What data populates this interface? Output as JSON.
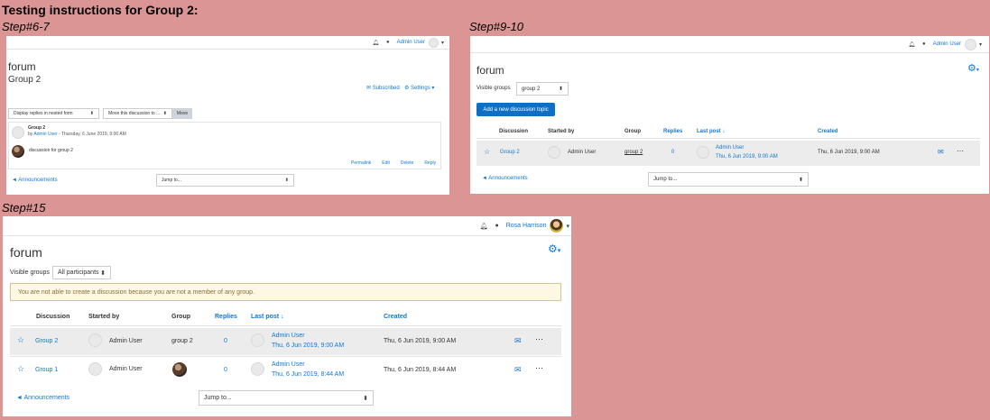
{
  "heading": "Testing instructions for Group 2:",
  "steps": {
    "s1": "Step#6-7",
    "s2": "Step#9-10",
    "s3": "Step#15"
  },
  "p1": {
    "user": "Admin User",
    "title": "forum",
    "subtitle": "Group 2",
    "subscribed": "Subscribed",
    "settings": "Settings",
    "display_select": "Display replies in nested form",
    "move_select": "Move this discussion to ...",
    "move_button": "Move",
    "post_title": "Group 2",
    "post_by": "by",
    "post_author": "Admin User",
    "post_date": " - Thursday, 6 June 2019, 9:00 AM",
    "post_body": "discussion for group 2",
    "actions": [
      "Permalink",
      "Edit",
      "Delete",
      "Reply"
    ],
    "announcements": "◄ Announcements",
    "jump": "Jump to..."
  },
  "p2": {
    "user": "Admin User",
    "title": "forum",
    "visible_groups_label": "Visible groups",
    "visible_groups_value": "group 2",
    "add_button": "Add a new discussion topic",
    "headers": {
      "discussion": "Discussion",
      "started_by": "Started by",
      "group": "Group",
      "replies": "Replies",
      "last_post": "Last post",
      "created": "Created"
    },
    "row": {
      "discussion": "Group 2",
      "started_by": "Admin User",
      "group": "group 2",
      "replies": "0",
      "last_user": "Admin User",
      "last_date": "Thu, 6 Jun 2019, 9:00 AM",
      "created": "Thu, 6 Jun 2019, 9:00 AM"
    },
    "announcements": "◄ Announcements",
    "jump": "Jump to..."
  },
  "p3": {
    "user": "Rosa Harrison",
    "title": "forum",
    "visible_groups_label": "Visible groups",
    "visible_groups_value": "All participants",
    "alert": "You are not able to create a discussion because you are not a member of any group.",
    "headers": {
      "discussion": "Discussion",
      "started_by": "Started by",
      "group": "Group",
      "replies": "Replies",
      "last_post": "Last post",
      "created": "Created"
    },
    "rows": [
      {
        "discussion": "Group 2",
        "started_by": "Admin User",
        "group": "group 2",
        "replies": "0",
        "last_user": "Admin User",
        "last_date": "Thu, 6 Jun 2019, 9:00 AM",
        "created": "Thu, 6 Jun 2019, 9:00 AM"
      },
      {
        "discussion": "Group 1",
        "started_by": "Admin User",
        "group": "",
        "replies": "0",
        "last_user": "Admin User",
        "last_date": "Thu, 6 Jun 2019, 8:44 AM",
        "created": "Thu, 6 Jun 2019, 8:44 AM"
      }
    ],
    "announcements": "◄ Announcements",
    "jump": "Jump to..."
  },
  "colors": {
    "background": "#dc9595",
    "link": "#1177d1",
    "primary_button": "#0f6fc5",
    "alert_bg": "#fcf8e3"
  }
}
